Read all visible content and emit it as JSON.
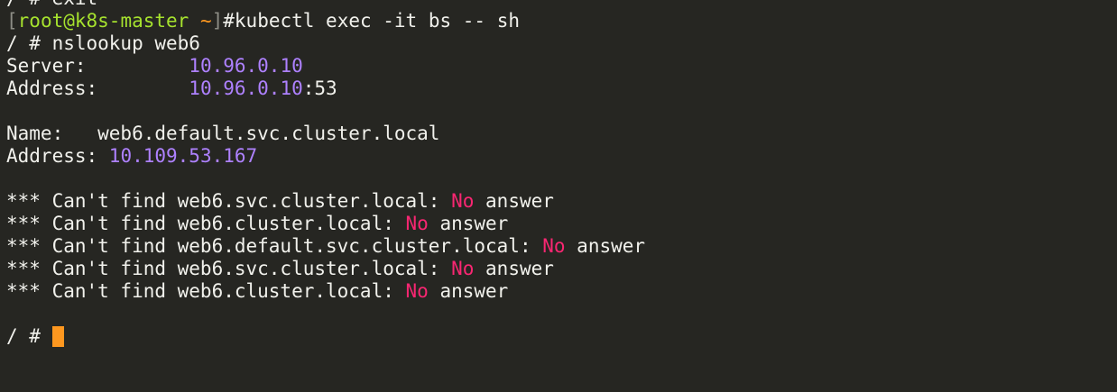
{
  "terminal": {
    "lines": [
      {
        "name": "prev-command-line",
        "segments": [
          {
            "text": "/ # exit",
            "color": "default"
          }
        ]
      },
      {
        "name": "shell-prompt-line",
        "segments": [
          {
            "text": "[",
            "color": "dim"
          },
          {
            "text": "root@k8s-master",
            "color": "green"
          },
          {
            "text": " ~",
            "color": "orange"
          },
          {
            "text": "]",
            "color": "dim"
          },
          {
            "text": "#kubectl exec -it bs -- sh",
            "color": "default"
          }
        ]
      },
      {
        "name": "nslookup-command-line",
        "segments": [
          {
            "text": "/ # nslookup web6",
            "color": "default"
          }
        ]
      },
      {
        "name": "server-line",
        "segments": [
          {
            "text": "Server:         ",
            "color": "default"
          },
          {
            "text": "10.96.0.10",
            "color": "purple"
          }
        ]
      },
      {
        "name": "server-address-line",
        "segments": [
          {
            "text": "Address:        ",
            "color": "default"
          },
          {
            "text": "10.96.0.10",
            "color": "purple"
          },
          {
            "text": ":53",
            "color": "default"
          }
        ]
      },
      {
        "name": "blank-line",
        "segments": []
      },
      {
        "name": "name-line",
        "segments": [
          {
            "text": "Name:   web6.default.svc.cluster.local",
            "color": "default"
          }
        ]
      },
      {
        "name": "result-address-line",
        "segments": [
          {
            "text": "Address: ",
            "color": "default"
          },
          {
            "text": "10.109.53.167",
            "color": "purple"
          }
        ]
      },
      {
        "name": "blank-line",
        "segments": []
      },
      {
        "name": "error-line",
        "segments": [
          {
            "text": "*** Can't find web6.svc.cluster.local: ",
            "color": "default"
          },
          {
            "text": "No",
            "color": "pink"
          },
          {
            "text": " answer",
            "color": "default"
          }
        ]
      },
      {
        "name": "error-line",
        "segments": [
          {
            "text": "*** Can't find web6.cluster.local: ",
            "color": "default"
          },
          {
            "text": "No",
            "color": "pink"
          },
          {
            "text": " answer",
            "color": "default"
          }
        ]
      },
      {
        "name": "error-line",
        "segments": [
          {
            "text": "*** Can't find web6.default.svc.cluster.local: ",
            "color": "default"
          },
          {
            "text": "No",
            "color": "pink"
          },
          {
            "text": " answer",
            "color": "default"
          }
        ]
      },
      {
        "name": "error-line",
        "segments": [
          {
            "text": "*** Can't find web6.svc.cluster.local: ",
            "color": "default"
          },
          {
            "text": "No",
            "color": "pink"
          },
          {
            "text": " answer",
            "color": "default"
          }
        ]
      },
      {
        "name": "error-line",
        "segments": [
          {
            "text": "*** Can't find web6.cluster.local: ",
            "color": "default"
          },
          {
            "text": "No",
            "color": "pink"
          },
          {
            "text": " answer",
            "color": "default"
          }
        ]
      },
      {
        "name": "blank-line",
        "segments": []
      },
      {
        "name": "current-prompt-line",
        "segments": [
          {
            "text": "/ # ",
            "color": "default"
          }
        ],
        "cursor": true
      }
    ]
  },
  "colors": {
    "background": "#262622",
    "default": "#f1f1ec",
    "green": "#a6e22e",
    "orange": "#fd971f",
    "purple": "#ae81ff",
    "pink": "#f92672",
    "dim": "#8d8d85",
    "cursor": "#fd971f"
  }
}
